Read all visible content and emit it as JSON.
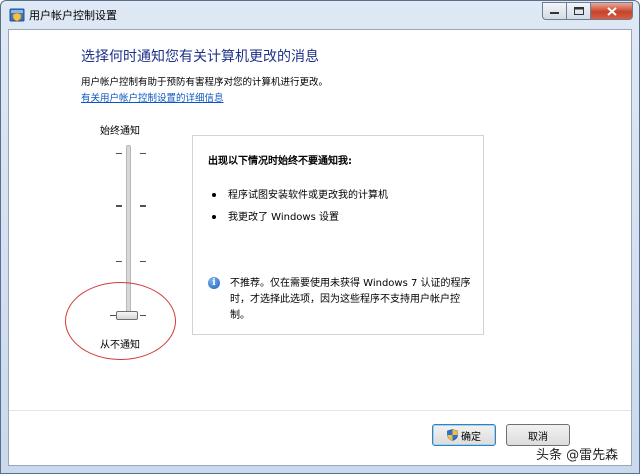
{
  "window": {
    "title": "用户帐户控制设置",
    "icon": "uac-shield-icon"
  },
  "main": {
    "heading": "选择何时通知您有关计算机更改的消息",
    "description": "用户帐户控制有助于预防有害程序对您的计算机进行更改。",
    "link_text": "有关用户帐户控制设置的详细信息"
  },
  "slider": {
    "top_label": "始终通知",
    "bottom_label": "从不通知",
    "levels": 4,
    "selected_level": 1
  },
  "panel": {
    "title": "出现以下情况时始终不要通知我:",
    "bullets": [
      "程序试图安装软件或更改我的计算机",
      "我更改了 Windows 设置"
    ],
    "info_text": "不推荐。仅在需要使用未获得 Windows 7 认证的程序时，才选择此选项，因为这些程序不支持用户帐户控制。"
  },
  "buttons": {
    "ok": "确定",
    "cancel": "取消"
  },
  "watermark": "头条 @雷先森",
  "colors": {
    "heading": "#1e3287",
    "link": "#0b56c0",
    "annotation": "#d23a3a"
  }
}
